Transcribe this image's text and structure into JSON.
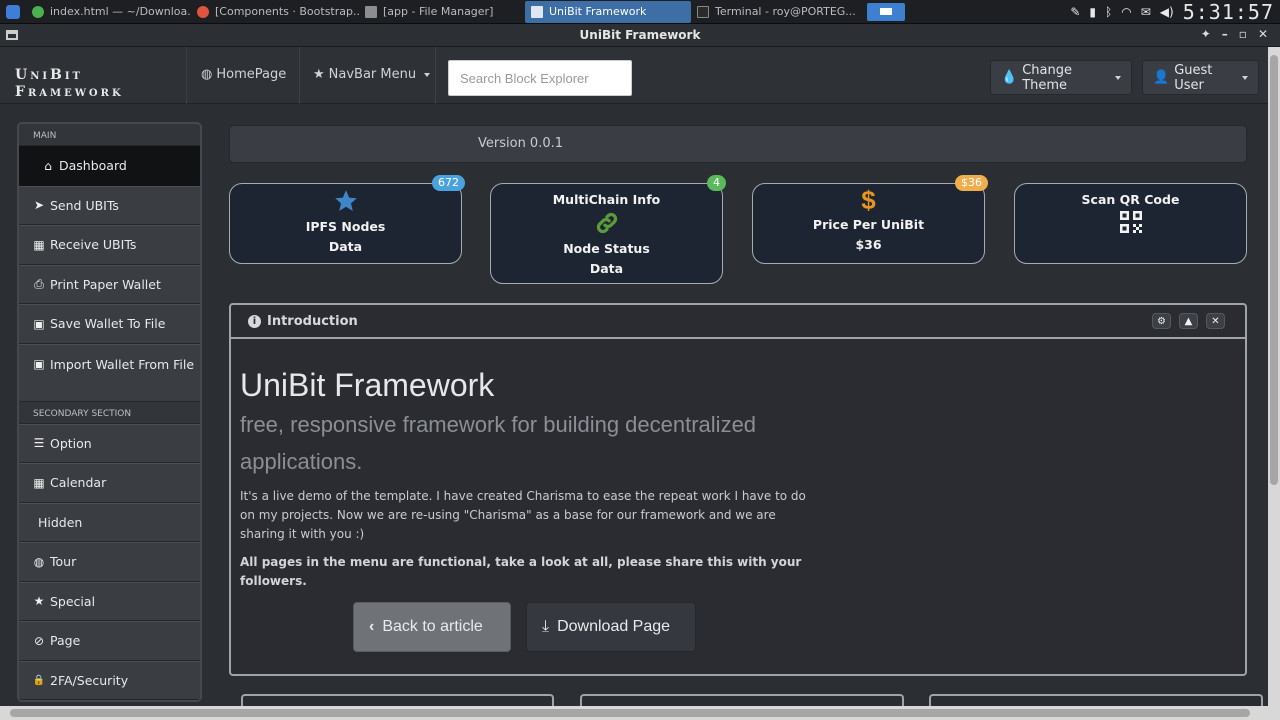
{
  "os_taskbar": {
    "tasks": [
      {
        "label": "index.html — ~/Downloa...",
        "color": "#4caf50"
      },
      {
        "label": "[Components · Bootstrap...",
        "color": "#e0533e"
      },
      {
        "label": "[app - File Manager]",
        "color": "#8a8d92"
      },
      {
        "label": "UniBit Framework",
        "color": "#dfe7f2",
        "active": true
      },
      {
        "label": "Terminal - roy@PORTEG...",
        "color": "#2b2b2b"
      }
    ],
    "clock": "5:31:57"
  },
  "window": {
    "title": "UniBit Framework",
    "controls": [
      "✦",
      "–",
      "▫",
      "✕"
    ]
  },
  "navbar": {
    "brand_line1": "UniBit",
    "brand_line2": "Framework",
    "homepage": "HomePage",
    "navbar_menu": "NavBar Menu",
    "search_placeholder": "Search Block Explorer",
    "change_theme": "Change Theme",
    "guest_user": "Guest User"
  },
  "sidebar": {
    "main_header": "MAIN",
    "main_items": [
      {
        "label": "Dashboard",
        "icon": "home-icon",
        "glyph": "⌂"
      },
      {
        "label": "Send UBITs",
        "icon": "send-icon",
        "glyph": "➤"
      },
      {
        "label": "Receive UBITs",
        "icon": "qr-code-icon",
        "glyph": "▦"
      },
      {
        "label": "Print Paper Wallet",
        "icon": "print-icon",
        "glyph": "⎙"
      },
      {
        "label": "Save Wallet To File",
        "icon": "save-icon",
        "glyph": "▣"
      },
      {
        "label": "Import Wallet From File",
        "icon": "import-icon",
        "glyph": "▣"
      }
    ],
    "secondary_header": "SECONDARY SECTION",
    "secondary_items": [
      {
        "label": "Option",
        "icon": "list-icon",
        "glyph": "☰"
      },
      {
        "label": "Calendar",
        "icon": "calendar-icon",
        "glyph": "▦"
      },
      {
        "label": "Hidden",
        "icon": "",
        "glyph": ""
      },
      {
        "label": "Tour",
        "icon": "globe-icon",
        "glyph": "◍"
      },
      {
        "label": "Special",
        "icon": "star-icon",
        "glyph": "★"
      },
      {
        "label": "Page",
        "icon": "ban-icon",
        "glyph": "⊘"
      },
      {
        "label": "2FA/Security",
        "icon": "lock-icon",
        "glyph": "🔒"
      }
    ]
  },
  "version": "Version 0.0.1",
  "cards": [
    {
      "badge": "672",
      "badge_color": "#4aa3df",
      "title": "IPFS Nodes",
      "subtitle": "Data",
      "icon": "star-icon",
      "icon_color": "#3e86c8"
    },
    {
      "badge": "4",
      "badge_color": "#5cb85c",
      "heading": "MultiChain Info",
      "title": "Node Status",
      "subtitle": "Data",
      "icon": "link-icon",
      "icon_color": "#5b9b3a"
    },
    {
      "badge": "$36",
      "badge_color": "#f0ad4e",
      "title": "Price Per UniBit",
      "subtitle": "$36",
      "icon": "dollar-icon",
      "icon_color": "#e8961e"
    },
    {
      "heading": "Scan QR Code",
      "icon": "qr-code-icon"
    }
  ],
  "intro": {
    "panel_title": "Introduction",
    "heading": "UniBit Framework",
    "subheading": "free, responsive framework for building decentralized applications.",
    "paragraph": "It's a live demo of the template. I have created Charisma to ease the repeat work I have to do on my projects. Now we are re-using \"Charisma\" as a base for our framework and we are sharing it with you :)",
    "bold_paragraph": "All pages in the menu are functional, take a look at all, please share this with your followers.",
    "back_button": "Back to article",
    "download_button": "Download Page"
  }
}
